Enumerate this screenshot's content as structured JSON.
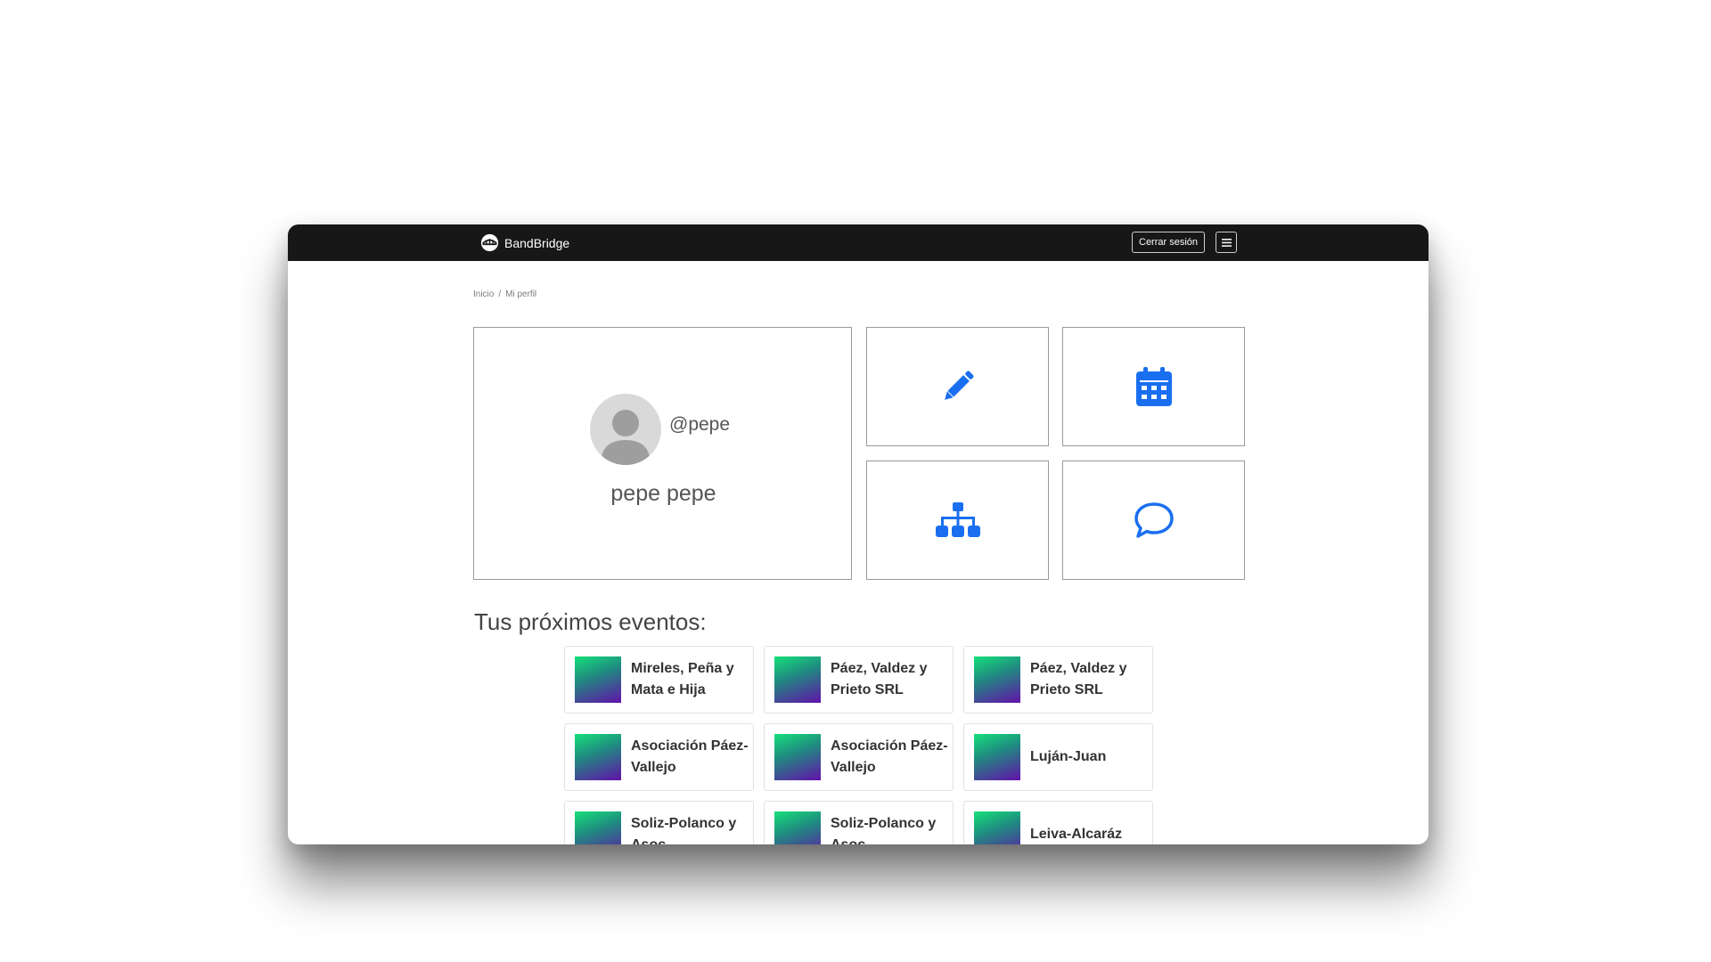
{
  "navbar": {
    "brand": "BandBridge",
    "logout_label": "Cerrar sesión",
    "menu_icon": "hamburger-icon"
  },
  "breadcrumb": {
    "home": "Inicio",
    "separator": "/",
    "current": "Mi perfil"
  },
  "profile": {
    "username": "@pepe",
    "full_name": "pepe pepe"
  },
  "tiles": [
    {
      "icon": "pencil-icon"
    },
    {
      "icon": "calendar-icon"
    },
    {
      "icon": "sitemap-icon"
    },
    {
      "icon": "chat-bubble-icon"
    }
  ],
  "events": {
    "title": "Tus próximos eventos:",
    "items": [
      {
        "name": "Mireles, Peña y Mata e Hija"
      },
      {
        "name": "Páez, Valdez y Prieto SRL"
      },
      {
        "name": "Páez, Valdez y Prieto SRL"
      },
      {
        "name": "Asociación Páez-Vallejo"
      },
      {
        "name": "Asociación Páez-Vallejo"
      },
      {
        "name": "Luján-Juan"
      },
      {
        "name": "Soliz-Polanco y Asoc."
      },
      {
        "name": "Soliz-Polanco y Asoc."
      },
      {
        "name": "Leiva-Alcaráz"
      }
    ]
  },
  "colors": {
    "accent": "#1a6ff0",
    "navbar": "#171717"
  }
}
